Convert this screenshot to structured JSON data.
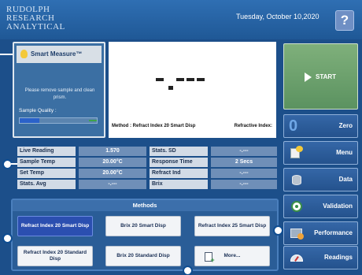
{
  "header": {
    "logo_lines": [
      "RUDOLPH",
      "RESEARCH",
      "ANALYTICAL"
    ],
    "date": "Tuesday, October 10,2020",
    "help_label": "?"
  },
  "smart_measure": {
    "title": "Smart Measure™",
    "message": "Please remove sample and clean prism.",
    "quality_label": "Sample Quality :",
    "quality_level": 0.25
  },
  "display": {
    "readout": "-.---",
    "method_text": "Method : Refract Index 20 Smart Disp",
    "refractive_label": "Refractive Index:"
  },
  "start": {
    "label": "START"
  },
  "side_buttons": [
    {
      "label": "Zero",
      "icon": "zero-icon"
    },
    {
      "label": "Menu",
      "icon": "menu-icon"
    },
    {
      "label": "Data",
      "icon": "database-icon"
    },
    {
      "label": "Validation",
      "icon": "target-icon"
    },
    {
      "label": "Performance",
      "icon": "performance-icon"
    },
    {
      "label": "Readings",
      "icon": "gauge-icon"
    }
  ],
  "readings": {
    "live_reading_label": "Live Reading",
    "live_reading_value": "1.570",
    "sample_temp_label": "Sample Temp",
    "sample_temp_value": "20.00°C",
    "set_temp_label": "Set Temp",
    "set_temp_value": "20.00°C",
    "stats_avg_label": "Stats. Avg",
    "stats_avg_value": "-.---",
    "stats_sd_label": "Stats. SD",
    "stats_sd_value": "-.---",
    "response_time_label": "Response Time",
    "response_time_value": "2 Secs",
    "refract_ind_label": "Refract Ind",
    "refract_ind_value": "-.---",
    "brix_label": "Brix",
    "brix_value": "-.---"
  },
  "methods": {
    "title": "Methods",
    "buttons": [
      "Refract Index 20 Smart Disp",
      "Brix 20 Smart Disp",
      "Refract Index 25 Smart Disp",
      "Refract Index 20 Standard Disp",
      "Brix 20 Standard Disp",
      "More..."
    ]
  },
  "colors": {
    "background": "#1c4f8a",
    "start_green": "#6ea16d",
    "selected_method": "#2b4fb0"
  }
}
